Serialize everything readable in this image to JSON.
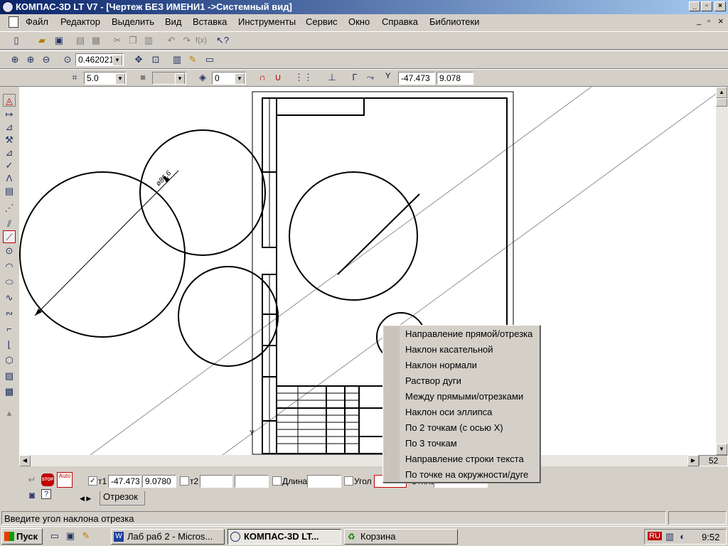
{
  "window": {
    "title": "КОМПАС-3D LT V7 - [Чертеж БЕЗ ИМЕНИ1 ->Системный вид]"
  },
  "menu": {
    "items": [
      "Файл",
      "Редактор",
      "Выделить",
      "Вид",
      "Вставка",
      "Инструменты",
      "Сервис",
      "Окно",
      "Справка",
      "Библиотеки"
    ]
  },
  "view_toolbar": {
    "zoom_value": "0.462021"
  },
  "current_toolbar": {
    "step_value": "5.0",
    "layer_value": "0",
    "coord_label": "Y",
    "coord_x": "-47.473",
    "coord_y": "9.078"
  },
  "drawing": {
    "dimension_label": "ø86,6"
  },
  "zoom_status": "52",
  "properties": {
    "t1_label": "т1",
    "t1_x": "-47.4730",
    "t1_y": "9.0780",
    "t2_label": "т2",
    "t2_x": "",
    "t2_y": "",
    "length_label": "Длина",
    "length_value": "",
    "angle_label": "Угол",
    "angle_value": "",
    "style_label": "Стиль",
    "tab_label": "Отрезок",
    "auto_label": "Auto",
    "stop_label": "STOP"
  },
  "status_text": "Введите угол наклона отрезка",
  "context_menu": {
    "items": [
      "Направление прямой/отрезка",
      "Наклон касательной",
      "Наклон нормали",
      "Раствор дуги",
      "Между прямыми/отрезками",
      "Наклон оси эллипса",
      "По 2 точкам (с осью X)",
      "По 3 точкам",
      "Направление строки текста",
      "По точке на окружности/дуге"
    ]
  },
  "taskbar": {
    "start_label": "Пуск",
    "tasks": [
      "Лаб раб 2 - Micros...",
      "КОМПАС-3D LT...",
      "Корзина"
    ],
    "lang": "RU",
    "clock": "9:52"
  }
}
